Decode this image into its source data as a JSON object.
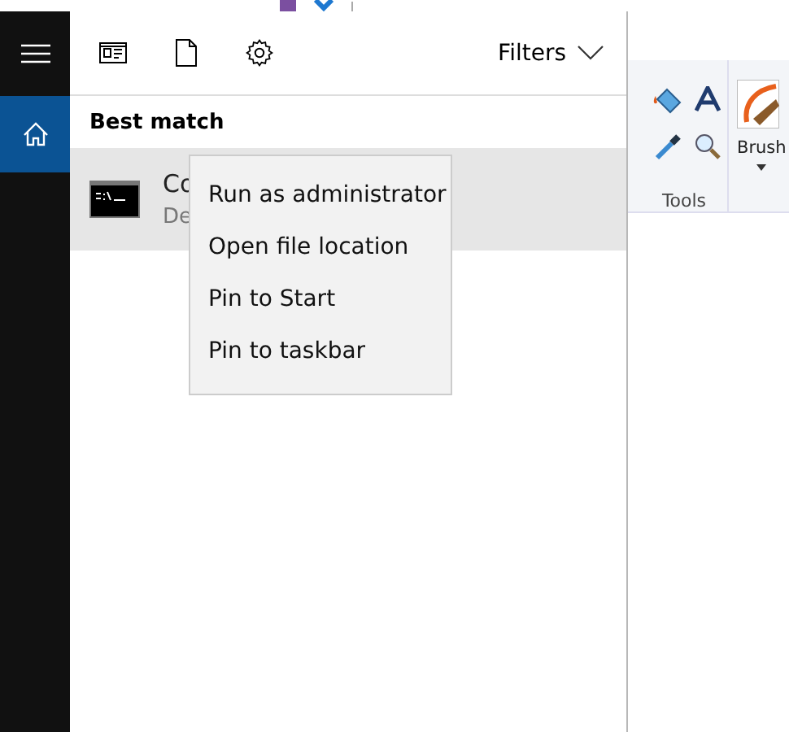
{
  "background_window": {
    "tools_label": "Tools",
    "brushes_label": "Brush"
  },
  "sidebar": {
    "items": [
      {
        "kind": "menu",
        "selected": false
      },
      {
        "kind": "home",
        "selected": true
      }
    ]
  },
  "toolbar": {
    "filters": "Filters"
  },
  "section_title": "Best match",
  "result": {
    "title": "Co",
    "subtitle": "De",
    "selected": true
  },
  "context_menu": [
    {
      "label": "Run as administrator"
    },
    {
      "label": "Open file location"
    },
    {
      "label": "Pin to Start"
    },
    {
      "label": "Pin to taskbar"
    }
  ]
}
